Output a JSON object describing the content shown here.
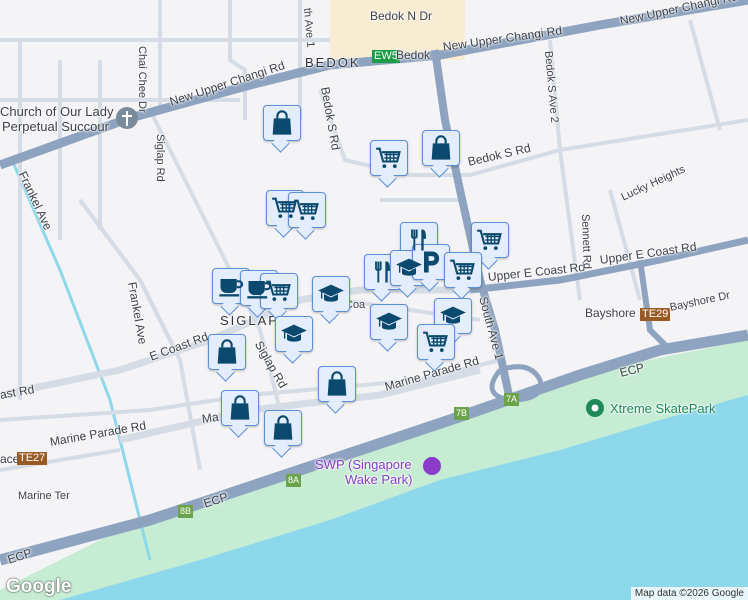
{
  "map": {
    "colors": {
      "background": "#f4f3f5",
      "major_road": "#8ea3bf",
      "minor_road": "#d5dce5",
      "water": "#8ed8ec",
      "park": "#c6ecd3",
      "marker_fill": "#e4edfc",
      "marker_border": "#5b8fd8",
      "icon": "#0b4a6e"
    },
    "labels": {
      "bedok_n": "Bedok N Dr",
      "bedok_area": "BEDOK",
      "bedok_station": "Bedok",
      "ew5": "EW5",
      "nuc_left": "New Upper Changi Rd",
      "nuc_mid": "New Upper Changi Rd",
      "nuc_right": "New Upper Changi Rd",
      "church": "Church of Our Lady",
      "church2": "Perpetual Succour",
      "chai_chee": "Chai Chee Dr",
      "siglap_rd_n": "Siglap Rd",
      "bedok_s_rd_v": "Bedok S Rd",
      "bedok_s_rd_h": "Bedok S Rd",
      "bedok_s_ave2": "Bedok S Ave 2",
      "bedok_n_ave1": "th Ave 1",
      "frankel": "Frankel Ave",
      "frankel2": "Frankel Ave",
      "e_coast": "E Coast Rd",
      "east_rd": "ast Rd",
      "siglap": "SIGLAP",
      "siglap_rd_s": "Siglap Rd",
      "marine_parade_1": "Marine Parade Rd",
      "marine_parade_2": "Marine Parade Rd",
      "marine_parade_3": "Ma    de Rd",
      "marine_ter": "Marine Ter",
      "ace": "ace",
      "te27": "TE27",
      "te29": "TE29",
      "bayshore": "Bayshore",
      "bayshore_dr": "Bayshore Dr",
      "upper_ec_1": "Upper E Coast Rd",
      "upper_ec_2": "Upper E Coast Rd",
      "sennett": "Sennett Rd",
      "lucky": "Lucky Heights",
      "south_ave1": "South Ave 1",
      "ecp1": "ECP",
      "ecp2": "ECP",
      "ecp3": "ECP",
      "exit_7a": "7A",
      "exit_7b": "7B",
      "exit_8a": "8A",
      "exit_8b": "8B",
      "swp1": "SWP (Singapore",
      "swp2": "Wake Park)",
      "skate": "Xtreme SkatePark",
      "coast": "Coa"
    },
    "markers": [
      {
        "type": "shopping"
      },
      {
        "type": "grocery"
      },
      {
        "type": "shopping"
      },
      {
        "type": "grocery"
      },
      {
        "type": "grocery"
      },
      {
        "type": "restaurant"
      },
      {
        "type": "grocery"
      },
      {
        "type": "cafe"
      },
      {
        "type": "cafe"
      },
      {
        "type": "grocery"
      },
      {
        "type": "school"
      },
      {
        "type": "restaurant"
      },
      {
        "type": "school"
      },
      {
        "type": "parking"
      },
      {
        "type": "grocery"
      },
      {
        "type": "school"
      },
      {
        "type": "school"
      },
      {
        "type": "school"
      },
      {
        "type": "grocery"
      },
      {
        "type": "shopping"
      },
      {
        "type": "shopping"
      },
      {
        "type": "shopping"
      },
      {
        "type": "shopping"
      }
    ],
    "logo": "Google",
    "attribution": "Map data ©2026 Google"
  }
}
